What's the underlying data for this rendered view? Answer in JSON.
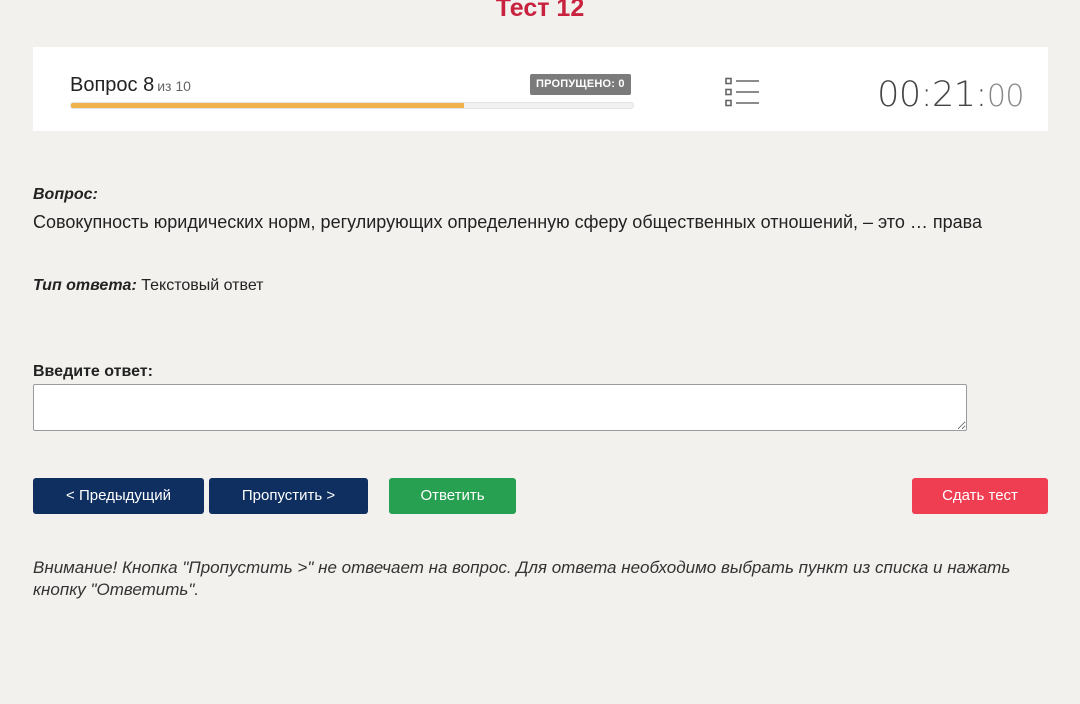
{
  "page": {
    "title": "Тест 12"
  },
  "status": {
    "question_label": "Вопрос 8",
    "of_label": "из 10",
    "progress": 0.7,
    "skipped_badge": "ПРОПУЩЕНО: 0",
    "list_icon": "list-icon",
    "timer_main": "00:21:",
    "timer_secs": "00"
  },
  "question": {
    "label": "Вопрос:",
    "text": "Совокупность юридических норм, регулирующих определенную сферу общественных отношений, – это … права",
    "type_label": "Тип ответа:",
    "type_value": "Текстовый ответ"
  },
  "answer": {
    "label": "Введите ответ:",
    "value": "",
    "placeholder": ""
  },
  "buttons": {
    "prev": "< Предыдущий",
    "skip": "Пропустить >",
    "answer": "Ответить",
    "submit": "Сдать тест"
  },
  "colors": {
    "title": "#c8223f",
    "progress": "#f0b24a",
    "nav_button": "#0f2f60",
    "answer_button": "#27a052",
    "submit_button": "#ef3e52"
  },
  "notice": "Внимание! Кнопка \"Пропустить >\" не отвечает на вопрос. Для ответа необходимо выбрать пункт из списка и нажать кнопку \"Ответить\"."
}
